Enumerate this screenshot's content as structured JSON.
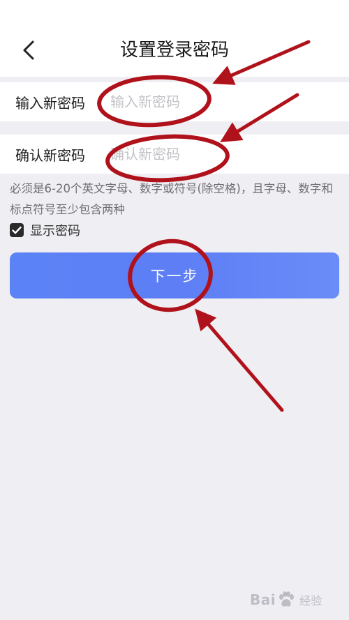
{
  "header": {
    "title": "设置登录密码",
    "back_icon": "chevron-left-icon"
  },
  "form": {
    "new_password": {
      "label": "输入新密码",
      "placeholder": "输入新密码",
      "value": ""
    },
    "confirm_password": {
      "label": "确认新密码",
      "placeholder": "确认新密码",
      "value": ""
    }
  },
  "hint": "必须是6-20个英文字母、数字或符号(除空格)，且字母、数字和标点符号至少包含两种",
  "show_password": {
    "label": "显示密码",
    "checked": true
  },
  "next_button": {
    "label": "下一步"
  },
  "watermark": {
    "text": "Bai",
    "text2": "经验"
  },
  "colors": {
    "background": "#efeef3",
    "button": "#5b83f6",
    "annotation_red": "#b0121b"
  }
}
